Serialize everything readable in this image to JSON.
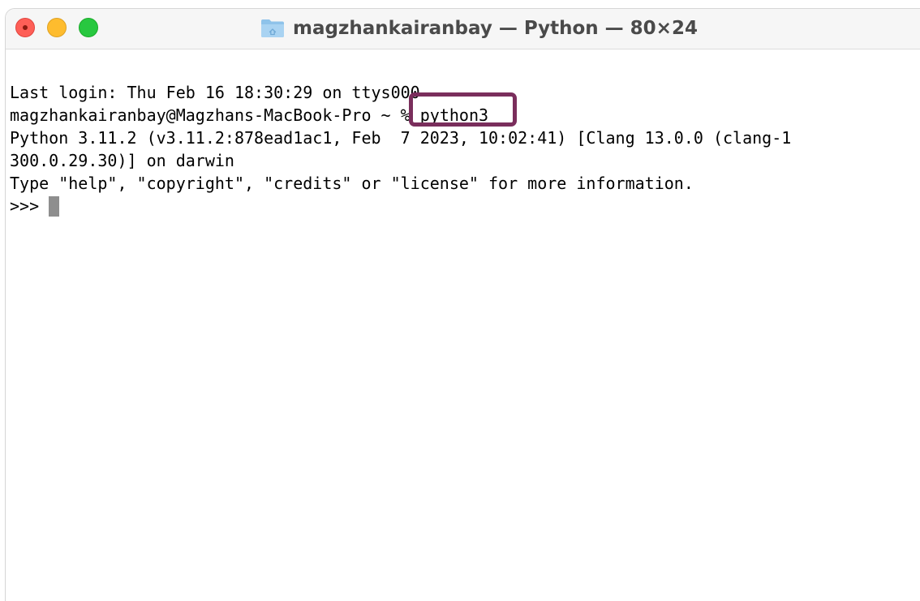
{
  "window": {
    "title": "magzhankairanbay — Python — 80×24",
    "title_icon": "folder-icon",
    "traffic_lights": {
      "close_color": "#fe5f57",
      "minimize_color": "#febc2e",
      "zoom_color": "#28c840"
    }
  },
  "terminal": {
    "last_login": "Last login: Thu Feb 16 18:30:29 on ttys000",
    "prompt": "magzhankairanbay@Magzhans-MacBook-Pro ~ % ",
    "command": "python3",
    "python_version_line1": "Python 3.11.2 (v3.11.2:878ead1ac1, Feb  7 2023, 10:02:41) [Clang 13.0.0 (clang-1",
    "python_version_line2": "300.0.29.30)] on darwin",
    "help_hint": "Type \"help\", \"copyright\", \"credits\" or \"license\" for more information.",
    "repl_prompt": ">>> "
  },
  "annotation": {
    "highlight_color": "#7a2e5c"
  }
}
